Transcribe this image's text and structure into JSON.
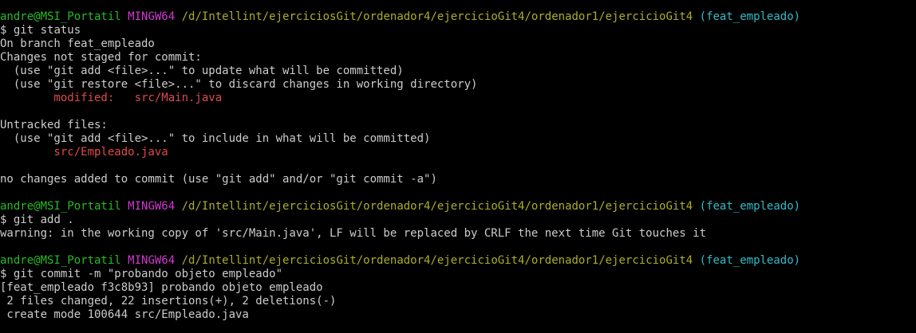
{
  "terminal": {
    "background": "#000000",
    "colors": {
      "user": "#25bc24",
      "shell": "#d338d3",
      "path": "#adad27",
      "branch": "#33bbc8",
      "text": "#cccccc",
      "red": "#e04a4a"
    },
    "prompt": {
      "user_host": "andre@MSI_Portatil",
      "shell": "MINGW64",
      "path": "/d/Intellint/ejerciciosGit/ordenador4/ejercicioGit4/ordenador1/ejercicioGit4",
      "branch": "(feat_empleado)",
      "symbol": "$"
    },
    "blocks": [
      {
        "command": "git status",
        "output": [
          {
            "text": "On branch feat_empleado",
            "style": "plain"
          },
          {
            "text": "Changes not staged for commit:",
            "style": "plain"
          },
          {
            "text": "  (use \"git add <file>...\" to update what will be committed)",
            "style": "plain"
          },
          {
            "text": "  (use \"git restore <file>...\" to discard changes in working directory)",
            "style": "plain"
          },
          {
            "text": "        modified:   src/Main.java",
            "style": "red"
          },
          {
            "text": "",
            "style": "plain"
          },
          {
            "text": "Untracked files:",
            "style": "plain"
          },
          {
            "text": "  (use \"git add <file>...\" to include in what will be committed)",
            "style": "plain"
          },
          {
            "text": "        src/Empleado.java",
            "style": "red"
          },
          {
            "text": "",
            "style": "plain"
          },
          {
            "text": "no changes added to commit (use \"git add\" and/or \"git commit -a\")",
            "style": "plain"
          },
          {
            "text": "",
            "style": "plain"
          }
        ]
      },
      {
        "command": "git add .",
        "output": [
          {
            "text": "warning: in the working copy of 'src/Main.java', LF will be replaced by CRLF the next time Git touches it",
            "style": "plain"
          },
          {
            "text": "",
            "style": "plain"
          }
        ]
      },
      {
        "command": "git commit -m \"probando objeto empleado\"",
        "output": [
          {
            "text": "[feat_empleado f3c8b93] probando objeto empleado",
            "style": "plain"
          },
          {
            "text": " 2 files changed, 22 insertions(+), 2 deletions(-)",
            "style": "plain"
          },
          {
            "text": " create mode 100644 src/Empleado.java",
            "style": "plain"
          }
        ]
      }
    ]
  }
}
